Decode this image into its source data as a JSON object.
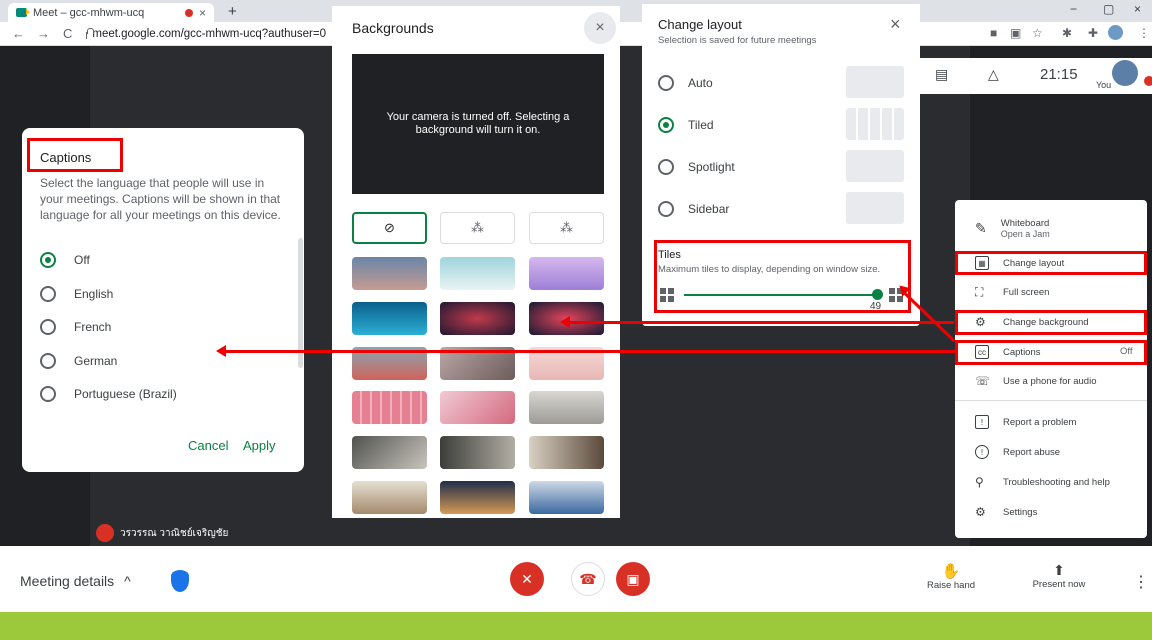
{
  "browser": {
    "tab_title": "Meet – gcc-mhwm-ucq",
    "tab_close": "×",
    "new_tab": "+",
    "url": "meet.google.com/gcc-mhwm-ucq?authuser=0",
    "back": "←",
    "forward": "→",
    "reload": "C",
    "minimize": "−",
    "maximize": "▢",
    "close": "×"
  },
  "meet_top": {
    "time": "21:15",
    "you_label": "You"
  },
  "captions": {
    "title": "Captions",
    "description": "Select the language that people will use in your meetings. Captions will be shown in that language for all your meetings on this device.",
    "options": [
      "Off",
      "English",
      "French",
      "German",
      "Portuguese (Brazil)"
    ],
    "selected": "Off",
    "cancel": "Cancel",
    "apply": "Apply"
  },
  "backgrounds": {
    "title": "Backgrounds",
    "close": "×",
    "preview_text": "Your camera is turned off. Selecting a background will turn it on.",
    "none_icon": "⊘",
    "blur_slight": "⁂",
    "blur_full": "⁂"
  },
  "layout": {
    "title": "Change layout",
    "subtitle": "Selection is saved for future meetings",
    "close": "×",
    "options": [
      "Auto",
      "Tiled",
      "Spotlight",
      "Sidebar"
    ],
    "selected": "Tiled",
    "tiles_title": "Tiles",
    "tiles_desc": "Maximum tiles to display, depending on window size.",
    "tiles_value": "49",
    "tiles_fraction": 1.0
  },
  "menu": {
    "whiteboard": "Whiteboard",
    "whiteboard_sub": "Open a Jam",
    "change_layout": "Change layout",
    "full_screen": "Full screen",
    "change_background": "Change background",
    "captions": "Captions",
    "captions_state": "Off",
    "phone_audio": "Use a phone for audio",
    "report_problem": "Report a problem",
    "report_abuse": "Report abuse",
    "troubleshooting": "Troubleshooting and help",
    "settings": "Settings"
  },
  "participant": {
    "name": "วรวรรณ วาณิชย์เจริญชัย"
  },
  "bottom": {
    "meeting_details": "Meeting details",
    "chevron": "^",
    "raise_hand": "Raise hand",
    "present_now": "Present now",
    "more": "⋮"
  },
  "colors": {
    "accent": "#0b8043",
    "highlight": "#ee0000",
    "end_call": "#d93025",
    "strip": "#9cc93c"
  }
}
